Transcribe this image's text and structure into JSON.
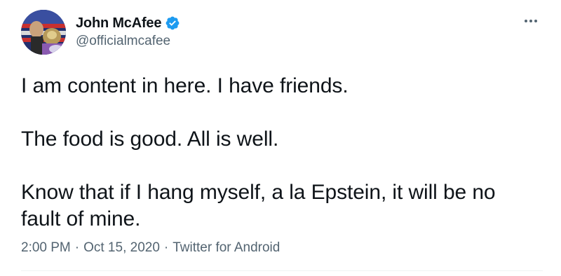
{
  "author": {
    "display_name": "John McAfee",
    "handle": "@officialmcafee",
    "verified": true,
    "avatar_icon": "profile-avatar"
  },
  "tweet": {
    "paragraphs": [
      "I am content in here. I have friends.",
      "The food is good. All is well.",
      "Know that if I hang myself, a la Epstein, it will be no fault of mine."
    ],
    "time": "2:00 PM",
    "date": "Oct 15, 2020",
    "source": "Twitter for Android",
    "separator": "·"
  },
  "icons": {
    "verified": "verified-badge-icon",
    "more": "more-options-icon"
  },
  "colors": {
    "primary_text": "#0f1419",
    "secondary_text": "#536471",
    "verified_blue": "#1d9bf0",
    "divider": "#eff3f4"
  }
}
